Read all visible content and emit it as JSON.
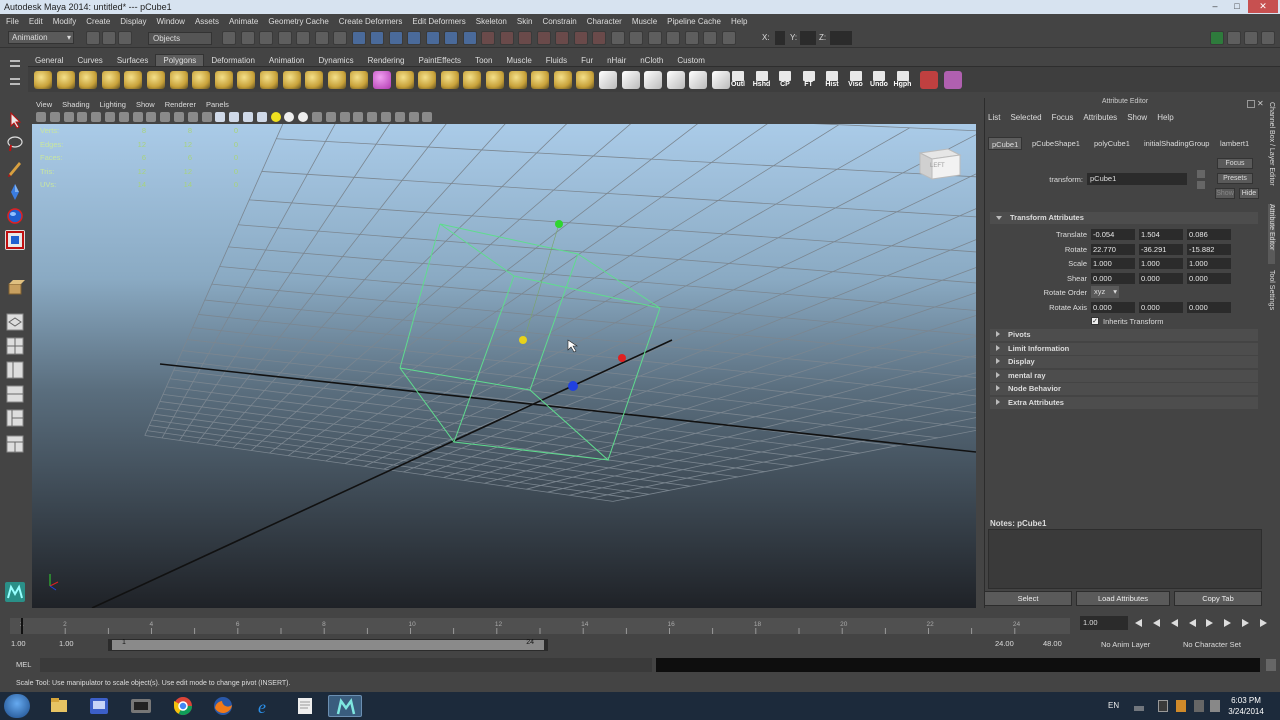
{
  "window": {
    "title": "Autodesk Maya 2014: untitled*   ---   pCube1"
  },
  "menubar": [
    "File",
    "Edit",
    "Modify",
    "Create",
    "Display",
    "Window",
    "Assets",
    "Animate",
    "Geometry Cache",
    "Create Deformers",
    "Edit Deformers",
    "Skeleton",
    "Skin",
    "Constrain",
    "Character",
    "Muscle",
    "Pipeline Cache",
    "Help"
  ],
  "status_line": {
    "mode": "Animation",
    "selection_mask": "Objects",
    "x_label": "X:",
    "y_label": "Y:",
    "z_label": "Z:"
  },
  "shelf_tabs": [
    "General",
    "Curves",
    "Surfaces",
    "Polygons",
    "Deformation",
    "Animation",
    "Dynamics",
    "Rendering",
    "PaintEffects",
    "Toon",
    "Muscle",
    "Fluids",
    "Fur",
    "nHair",
    "nCloth",
    "Custom"
  ],
  "shelf_active": "Polygons",
  "shelf_text_buttons": [
    "Outl",
    "Hshd",
    "CP",
    "FT",
    "Hist",
    "Viso",
    "Undo",
    "Hgph"
  ],
  "viewport_menu": [
    "View",
    "Shading",
    "Lighting",
    "Show",
    "Renderer",
    "Panels"
  ],
  "hud": [
    {
      "label": "Verts:",
      "a": "8",
      "b": "8",
      "c": "0"
    },
    {
      "label": "Edges:",
      "a": "12",
      "b": "12",
      "c": "0"
    },
    {
      "label": "Faces:",
      "a": "6",
      "b": "6",
      "c": "0"
    },
    {
      "label": "Tris:",
      "a": "12",
      "b": "12",
      "c": "0"
    },
    {
      "label": "UVs:",
      "a": "14",
      "b": "14",
      "c": "0"
    }
  ],
  "viewcube": {
    "face": "LEFT"
  },
  "attribute_editor": {
    "title": "Attribute Editor",
    "menu": [
      "List",
      "Selected",
      "Focus",
      "Attributes",
      "Show",
      "Help"
    ],
    "node_tabs": [
      "pCube1",
      "pCubeShape1",
      "polyCube1",
      "initialShadingGroup",
      "lambert1"
    ],
    "active_tab": "pCube1",
    "transform_label": "transform:",
    "transform_value": "pCube1",
    "focus_btn": "Focus",
    "presets_btn": "Presets",
    "show_btn": "Show",
    "hide_btn": "Hide",
    "section": "Transform Attributes",
    "rows": [
      {
        "label": "Translate",
        "v": [
          "-0.054",
          "1.504",
          "0.086"
        ]
      },
      {
        "label": "Rotate",
        "v": [
          "22.770",
          "-36.291",
          "-15.882"
        ]
      },
      {
        "label": "Scale",
        "v": [
          "1.000",
          "1.000",
          "1.000"
        ]
      },
      {
        "label": "Shear",
        "v": [
          "0.000",
          "0.000",
          "0.000"
        ]
      }
    ],
    "rotate_order_label": "Rotate Order",
    "rotate_order_value": "xyz",
    "rotate_axis_label": "Rotate Axis",
    "rotate_axis": [
      "0.000",
      "0.000",
      "0.000"
    ],
    "inherits_label": "Inherits Transform",
    "collapsed_sections": [
      "Pivots",
      "Limit Information",
      "Display",
      "mental ray",
      "Node Behavior",
      "Extra Attributes"
    ],
    "notes_label": "Notes: pCube1",
    "buttons": [
      "Select",
      "Load Attributes",
      "Copy Tab"
    ]
  },
  "right_tabs": [
    "Channel Box / Layer Editor",
    "Attribute Editor",
    "Tool Settings"
  ],
  "time_slider": {
    "ticks": [
      "1",
      "2",
      "4",
      "6",
      "8",
      "10",
      "12",
      "14",
      "16",
      "18",
      "20",
      "22",
      "24"
    ],
    "current": "1.00"
  },
  "range_slider": {
    "start": "1.00",
    "inner_start": "1.00",
    "range_start_label": "1",
    "range_end_label": "24",
    "end": "24.00",
    "outer_end": "48.00",
    "anim_layer": "No Anim Layer",
    "char_set": "No Character Set"
  },
  "command_line": {
    "label": "MEL"
  },
  "help_line": "Scale Tool: Use manipulator to scale object(s). Use edit mode to change pivot (INSERT).",
  "taskbar": {
    "lang": "EN",
    "time": "6:03 PM",
    "date": "3/24/2014"
  },
  "colors": {
    "wire": "#5fdc8e",
    "x_axis": "#e02020",
    "y_axis": "#2fd62f",
    "z_axis": "#2040e0",
    "center": "#e8d21a"
  }
}
